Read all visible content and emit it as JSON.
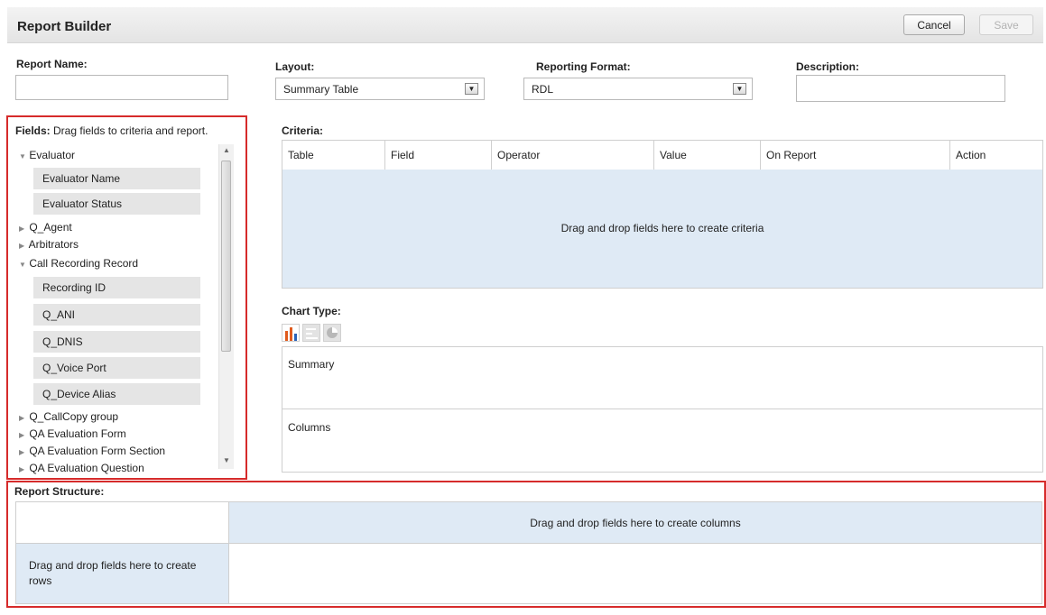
{
  "header": {
    "title": "Report Builder",
    "cancel_label": "Cancel",
    "save_label": "Save"
  },
  "report_name": {
    "label": "Report Name:",
    "value": ""
  },
  "layout": {
    "label": "Layout:",
    "selected": "Summary Table"
  },
  "reporting_format": {
    "label": "Reporting Format:",
    "selected": "RDL"
  },
  "description": {
    "label": "Description:",
    "value": ""
  },
  "fields_panel": {
    "title": "Fields:",
    "hint": "Drag fields to criteria and report.",
    "tree": [
      {
        "label": "Evaluator",
        "expanded": true,
        "children": [
          "Evaluator Name",
          "Evaluator Status"
        ]
      },
      {
        "label": "Q_Agent",
        "expanded": false
      },
      {
        "label": "Arbitrators",
        "expanded": false
      },
      {
        "label": "Call Recording Record",
        "expanded": true,
        "children": [
          "Recording ID",
          "Q_ANI",
          "Q_DNIS",
          "Q_Voice Port",
          "Q_Device Alias"
        ]
      },
      {
        "label": "Q_CallCopy group",
        "expanded": false
      },
      {
        "label": "QA Evaluation Form",
        "expanded": false
      },
      {
        "label": "QA Evaluation Form Section",
        "expanded": false
      },
      {
        "label": "QA Evaluation Question",
        "expanded": false
      }
    ]
  },
  "criteria": {
    "label": "Criteria:",
    "columns": [
      "Table",
      "Field",
      "Operator",
      "Value",
      "On Report",
      "Action"
    ],
    "empty_message": "Drag and drop fields here to create criteria"
  },
  "chart_type": {
    "label": "Chart Type:",
    "icons": [
      "bar-chart-icon",
      "horizontal-bar-chart-icon",
      "pie-chart-icon"
    ],
    "accent": "#e05a1c"
  },
  "summary_box": {
    "label": "Summary"
  },
  "columns_box": {
    "label": "Columns"
  },
  "report_structure": {
    "label": "Report Structure:",
    "columns_message": "Drag and drop fields here to create columns",
    "rows_message": "Drag and drop fields here to create rows"
  },
  "colors": {
    "highlight": "#d62b2b",
    "drop_zone": "#dfeaf5"
  }
}
